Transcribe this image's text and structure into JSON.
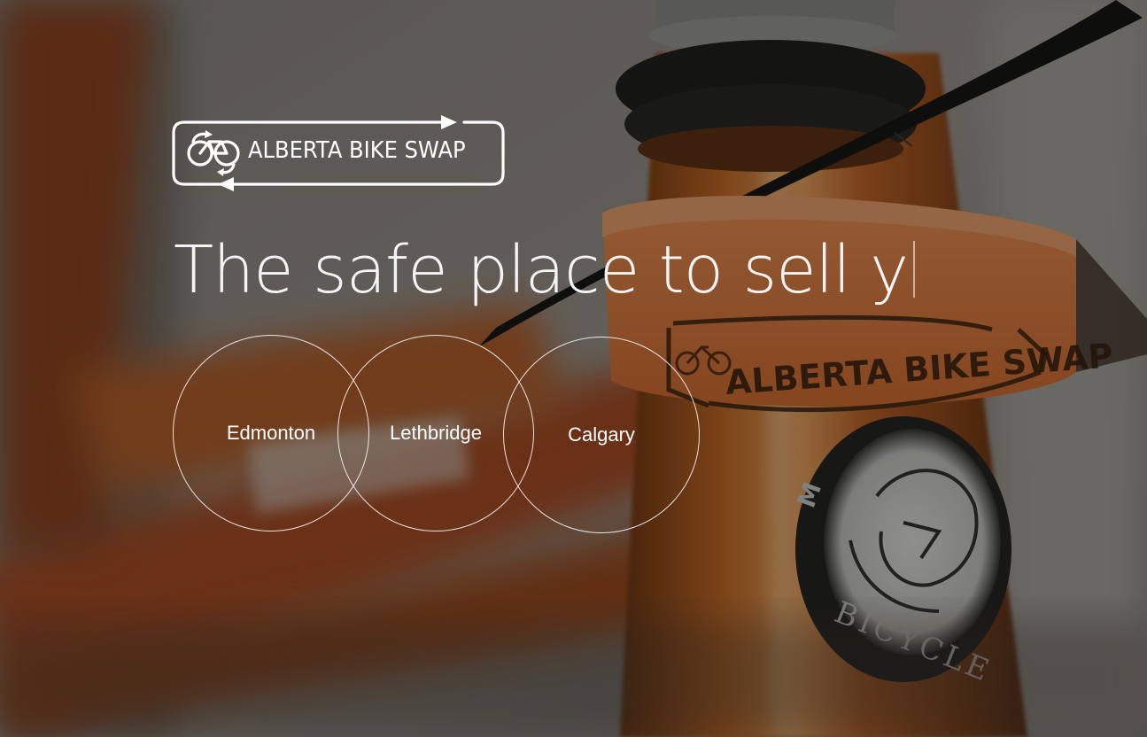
{
  "brand": {
    "name": "ALBERTA BIKE SWAP",
    "color": "#ffffff"
  },
  "hero": {
    "headline": "The safe place to sell y",
    "background_photo": "orange bicycle head tube with Alberta Bike Swap tag"
  },
  "cities": [
    {
      "label": "Edmonton"
    },
    {
      "label": "Lethbridge"
    },
    {
      "label": "Calgary"
    }
  ],
  "tag": {
    "text": "ALBERTA BIKE SWAP",
    "color": "#e0783a"
  },
  "colors": {
    "frame_orange": "#b8561c",
    "overlay": "#141210"
  }
}
